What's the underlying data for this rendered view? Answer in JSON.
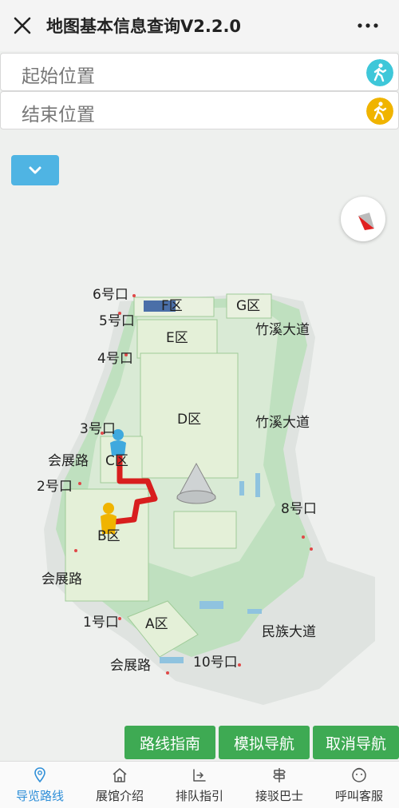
{
  "header": {
    "title": "地图基本信息查询V2.2.0",
    "close_icon": "close-icon",
    "more_icon": "more-icon"
  },
  "start_field": {
    "placeholder": "起始位置",
    "icon": "walker-icon",
    "icon_color": "#3ec7d9"
  },
  "end_field": {
    "placeholder": "结束位置",
    "icon": "walker-icon",
    "icon_color": "#f0b400"
  },
  "map": {
    "layer_toggle_icon": "chevron-down-icon",
    "compass_icon": "compass-icon",
    "labels": {
      "gate6": "6号口",
      "gate5": "5号口",
      "gate4": "4号口",
      "gate3": "3号口",
      "gate2": "2号口",
      "gate1": "1号口",
      "gate8": "8号口",
      "gate10": "10号口",
      "zone_f": "F区",
      "zone_g": "G区",
      "zone_e": "E区",
      "zone_d": "D区",
      "zone_c": "C区",
      "zone_b": "B区",
      "zone_a": "A区",
      "road_zhuxi_1": "竹溪大道",
      "road_zhuxi_2": "竹溪大道",
      "road_huizhan_1": "会展路",
      "road_huizhan_2": "会展路",
      "road_huizhan_3": "会展路",
      "road_minzu": "民族大道"
    },
    "route_color": "#d81e1e",
    "start_marker_color": "#3fa9de",
    "end_marker_color": "#f0b400"
  },
  "actions": {
    "route_guide": "路线指南",
    "simulate_nav": "模拟导航",
    "cancel_nav": "取消导航"
  },
  "tabs": [
    {
      "label": "导览路线",
      "icon": "location-pin-icon"
    },
    {
      "label": "展馆介绍",
      "icon": "home-icon"
    },
    {
      "label": "排队指引",
      "icon": "queue-icon"
    },
    {
      "label": "接驳巴士",
      "icon": "bus-stop-icon"
    },
    {
      "label": "呼叫客服",
      "icon": "customer-service-icon"
    }
  ],
  "colors": {
    "accent_green": "#3eaa53",
    "active_tab": "#2f8fd8"
  }
}
